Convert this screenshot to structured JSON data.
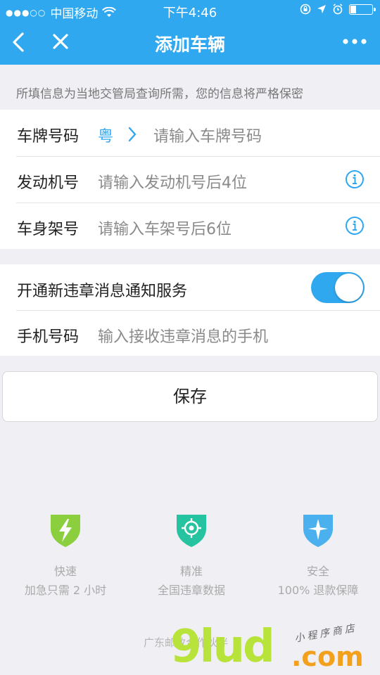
{
  "status_bar": {
    "carrier": "中国移动",
    "time": "下午4:46",
    "battery_level": 0.3
  },
  "nav": {
    "title": "添加车辆",
    "back_icon": "chevron-left-icon",
    "close_icon": "close-icon",
    "more_icon": "more-icon"
  },
  "notice": "所填信息为当地交管局查询所需，您的信息将严格保密",
  "vehicle_form": {
    "plate": {
      "label": "车牌号码",
      "province": "粤",
      "placeholder": "请输入车牌号码"
    },
    "engine": {
      "label": "发动机号",
      "placeholder": "请输入发动机号后4位"
    },
    "frame": {
      "label": "车身架号",
      "placeholder": "请输入车架号后6位"
    }
  },
  "notification": {
    "label": "开通新违章消息通知服务",
    "enabled": true,
    "phone_label": "手机号码",
    "phone_placeholder": "输入接收违章消息的手机"
  },
  "save_label": "保存",
  "features": [
    {
      "title": "快速",
      "desc": "加急只需 2 小时",
      "color": "#8ccf3e",
      "icon": "lightning-shield-icon"
    },
    {
      "title": "精准",
      "desc": "全国违章数据",
      "color": "#26c3a0",
      "icon": "target-shield-icon"
    },
    {
      "title": "安全",
      "desc": "100% 退款保障",
      "color": "#4ab0ee",
      "icon": "star-shield-icon"
    }
  ],
  "footer_note": "广东邮政合作伙伴",
  "watermark": {
    "brand": "9lud",
    "domain": ".com",
    "tagline": "小程序商店"
  },
  "colors": {
    "accent": "#2fa8f0",
    "background": "#efeff4"
  }
}
